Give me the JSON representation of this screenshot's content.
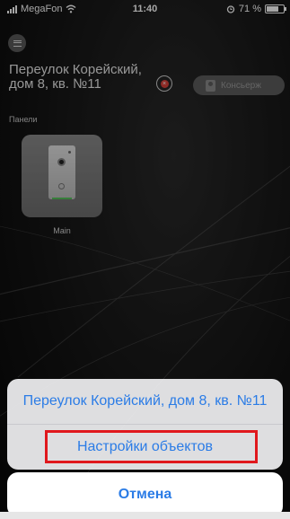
{
  "status_bar": {
    "carrier": "MegaFon",
    "time": "11:40",
    "battery": "71 %",
    "battery_level": 0.71
  },
  "header": {
    "object_title": "Переулок Корейский, дом 8, кв. №11",
    "concierge_label": "Консьерж"
  },
  "panels": {
    "section_label": "Панели",
    "items": [
      {
        "name": "Main"
      }
    ]
  },
  "action_sheet": {
    "items": [
      {
        "label": "Переулок Корейский, дом 8, кв. №11"
      },
      {
        "label": "Настройки объектов"
      }
    ],
    "cancel_label": "Отмена"
  },
  "colors": {
    "accent_blue": "#2b7ce6",
    "highlight_red": "#e0181d",
    "delete_red": "#d9413a"
  }
}
